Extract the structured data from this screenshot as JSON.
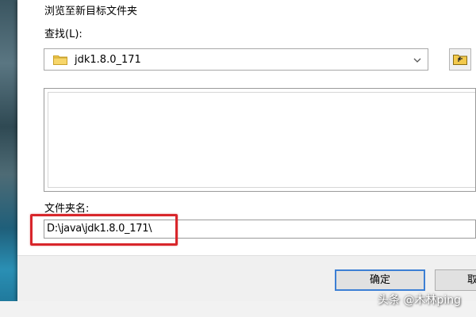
{
  "dialog": {
    "title": "浏览至新目标文件夹",
    "lookin_label": "查找(L):",
    "lookin_value": "jdk1.8.0_171",
    "foldername_label": "文件夹名:",
    "foldername_value": "D:\\java\\jdk1.8.0_171\\",
    "ok_label": "确定",
    "cancel_label": "取"
  },
  "icons": {
    "lookin_folder": "folder-icon",
    "dropdown": "chevron-down-icon",
    "up_folder": "up-folder-icon"
  },
  "colors": {
    "highlight": "#d8262b",
    "default_button_border": "#3c7fd4",
    "folder_yellow": "#f2c94c"
  },
  "watermark": "头条 @木林ping"
}
